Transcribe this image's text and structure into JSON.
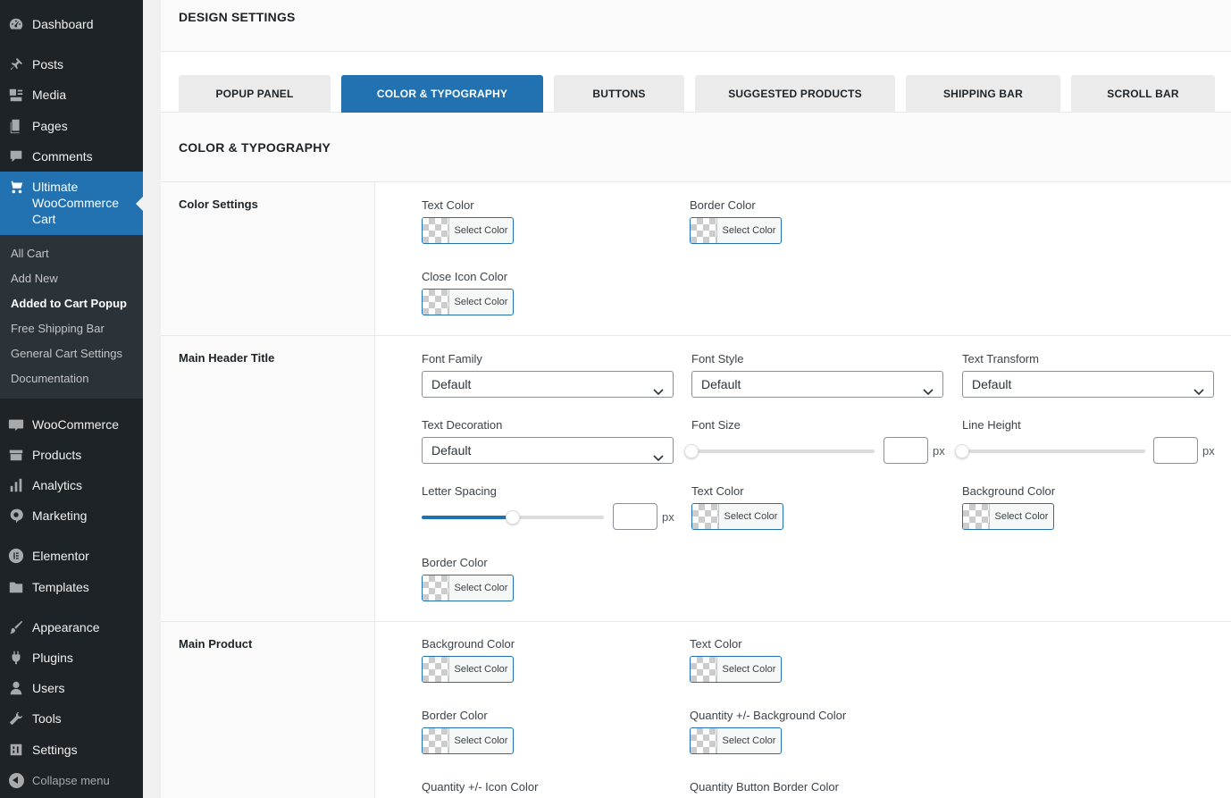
{
  "sidebar": {
    "dashboard": "Dashboard",
    "posts": "Posts",
    "media": "Media",
    "pages": "Pages",
    "comments": "Comments",
    "ultimate": "Ultimate WooCommerce Cart",
    "submenu": [
      "All Cart",
      "Add New",
      "Added to Cart Popup",
      "Free Shipping Bar",
      "General Cart Settings",
      "Documentation"
    ],
    "woocommerce": "WooCommerce",
    "products": "Products",
    "analytics": "Analytics",
    "marketing": "Marketing",
    "elementor": "Elementor",
    "templates": "Templates",
    "appearance": "Appearance",
    "plugins": "Plugins",
    "users": "Users",
    "tools": "Tools",
    "settings": "Settings",
    "collapse": "Collapse menu"
  },
  "main": {
    "design_title": "DESIGN SETTINGS",
    "tabs": [
      "POPUP PANEL",
      "COLOR & TYPOGRAPHY",
      "BUTTONS",
      "SUGGESTED PRODUCTS",
      "SHIPPING BAR",
      "SCROLL BAR"
    ],
    "active_tab": "COLOR & TYPOGRAPHY",
    "section_title": "COLOR & TYPOGRAPHY",
    "select_color": "Select Color",
    "px": "px",
    "color_settings": {
      "label": "Color Settings",
      "text_color": "Text Color",
      "border_color": "Border Color",
      "close_icon_color": "Close Icon Color"
    },
    "main_header": {
      "label": "Main Header Title",
      "font_family": "Font Family",
      "font_family_value": "Default",
      "font_style": "Font Style",
      "font_style_value": "Default",
      "text_transform": "Text Transform",
      "text_transform_value": "Default",
      "text_decoration": "Text Decoration",
      "text_decoration_value": "Default",
      "font_size": "Font Size",
      "line_height": "Line Height",
      "letter_spacing": "Letter Spacing",
      "letter_spacing_slider_fraction": 0.5,
      "text_color": "Text Color",
      "background_color": "Background Color",
      "border_color": "Border Color"
    },
    "main_product": {
      "label": "Main Product",
      "background_color": "Background Color",
      "text_color": "Text Color",
      "border_color": "Border Color",
      "qty_bg_color": "Quantity +/- Background Color",
      "qty_icon_color": "Quantity +/- Icon Color",
      "qty_border_color": "Quantity Button Border Color"
    }
  }
}
